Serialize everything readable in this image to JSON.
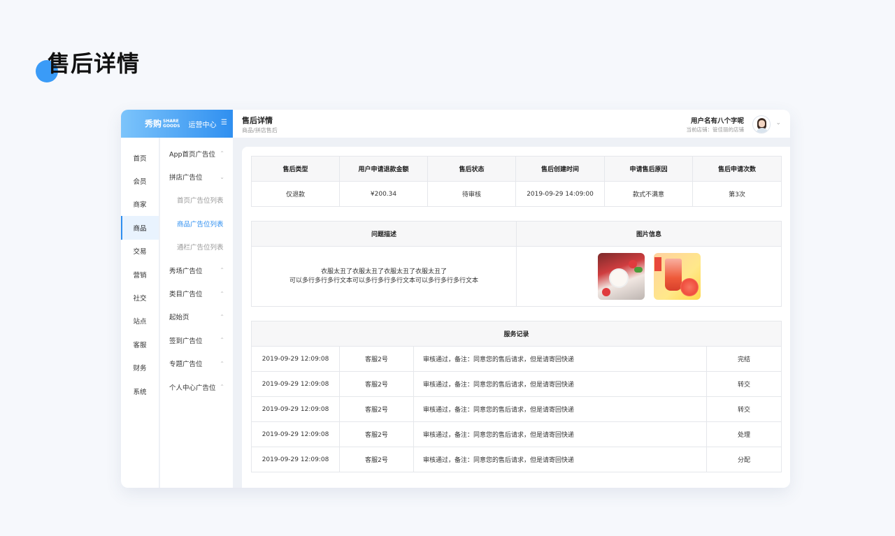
{
  "page_heading": "售后详情",
  "brand": {
    "logo_mark": "秀购",
    "logo_en_1": "SHARE",
    "logo_en_2": "GOODS",
    "center": "运营中心",
    "menu_icon": "menu-icon"
  },
  "topbar": {
    "title": "售后详情",
    "breadcrumb": "商品/拼店售后",
    "username": "用户名有八个字呢",
    "store": "当前店铺：管佳丽的店铺"
  },
  "rail": [
    "首页",
    "会员",
    "商家",
    "商品",
    "交易",
    "营销",
    "社交",
    "站点",
    "客服",
    "财务",
    "系统"
  ],
  "rail_active": "商品",
  "subnav": [
    {
      "label": "App首页广告位",
      "type": "group"
    },
    {
      "label": "拼店广告位",
      "type": "group-open"
    },
    {
      "label": "首页广告位列表",
      "type": "child"
    },
    {
      "label": "商品广告位列表",
      "type": "child-active"
    },
    {
      "label": "通栏广告位列表",
      "type": "child"
    },
    {
      "label": "秀场广告位",
      "type": "group"
    },
    {
      "label": "类目广告位",
      "type": "group"
    },
    {
      "label": "起始页",
      "type": "group"
    },
    {
      "label": "签到广告位",
      "type": "group"
    },
    {
      "label": "专题广告位",
      "type": "group"
    },
    {
      "label": "个人中心广告位",
      "type": "group"
    }
  ],
  "summary": {
    "headers": [
      "售后类型",
      "用户申请退款金额",
      "售后状态",
      "售后创建时间",
      "申请售后原因",
      "售后申请次数"
    ],
    "values": [
      "仅退款",
      "¥200.34",
      "待审核",
      "2019-09-29 14:09:00",
      "款式不满意",
      "第3次"
    ]
  },
  "problem": {
    "header_desc": "问题描述",
    "header_pics": "图片信息",
    "line1": "衣服太丑了衣服太丑了衣服太丑了衣服太丑了",
    "line2": "可以多行多行多行文本可以多行多行多行文本可以多行多行多行文本"
  },
  "records": {
    "title": "服务记录",
    "rows": [
      {
        "time": "2019-09-29 12:09:08",
        "agent": "客服2号",
        "note": "审核通过，备注：同意您的售后请求，但是请寄回快递",
        "status": "完结"
      },
      {
        "time": "2019-09-29 12:09:08",
        "agent": "客服2号",
        "note": "审核通过，备注：同意您的售后请求，但是请寄回快递",
        "status": "转交"
      },
      {
        "time": "2019-09-29 12:09:08",
        "agent": "客服2号",
        "note": "审核通过，备注：同意您的售后请求，但是请寄回快递",
        "status": "转交"
      },
      {
        "time": "2019-09-29 12:09:08",
        "agent": "客服2号",
        "note": "审核通过，备注：同意您的售后请求，但是请寄回快递",
        "status": "处理"
      },
      {
        "time": "2019-09-29 12:09:08",
        "agent": "客服2号",
        "note": "审核通过，备注：同意您的售后请求，但是请寄回快递",
        "status": "分配"
      }
    ]
  },
  "colors": {
    "accent": "#2f8ff0",
    "hero_dot": "#3a9bf7",
    "background": "#f6f8fc"
  }
}
